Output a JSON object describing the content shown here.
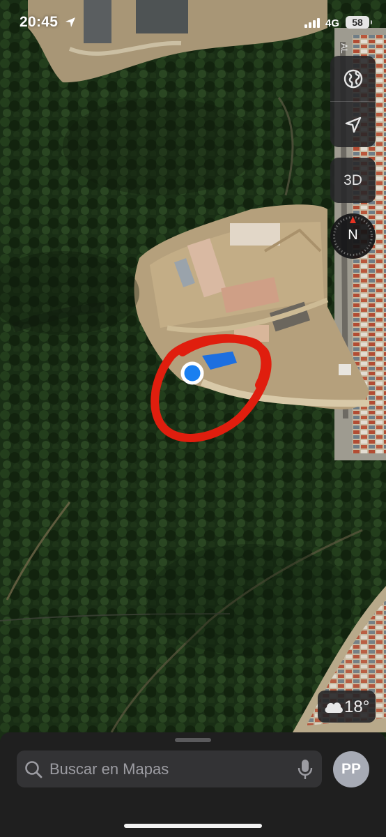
{
  "status_bar": {
    "time": "20:45",
    "network": "4G",
    "battery": "58"
  },
  "map": {
    "street_label": "AL",
    "annotation_color": "#e01e0e",
    "location_dot_color": "#1a7ff0"
  },
  "controls": {
    "map_mode_icon": "globe-icon",
    "locate_icon": "location-arrow-icon",
    "view_3d_label": "3D",
    "compass_label": "N"
  },
  "weather": {
    "icon": "cloud-icon",
    "temperature": "18°"
  },
  "search": {
    "placeholder": "Buscar en Mapas",
    "avatar_initials": "PP"
  }
}
